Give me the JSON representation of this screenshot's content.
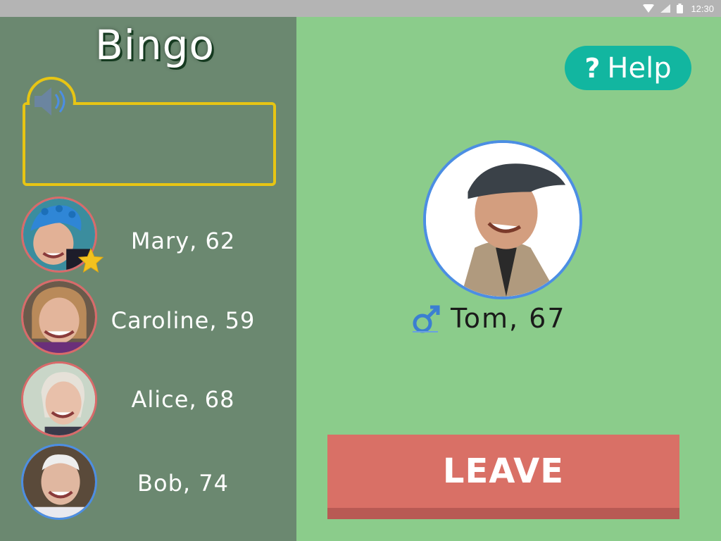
{
  "status_bar": {
    "time": "12:30",
    "icons": [
      "wifi-icon",
      "signal-icon",
      "battery-icon"
    ]
  },
  "app": {
    "title": "Bingo"
  },
  "call_box": {
    "icon": "speaker-icon",
    "text": ""
  },
  "players": [
    {
      "label": "Mary, 62",
      "avatar": "photo",
      "gender": "female",
      "starred": true
    },
    {
      "label": "Caroline, 59",
      "avatar": "photo",
      "gender": "female",
      "starred": false
    },
    {
      "label": "Alice, 68",
      "avatar": "photo",
      "gender": "female",
      "starred": false
    },
    {
      "label": "Bob, 74",
      "avatar": "photo",
      "gender": "male",
      "starred": false
    }
  ],
  "help": {
    "icon": "?",
    "label": "Help"
  },
  "current_user": {
    "label": "Tom, 67",
    "gender_icon": "male-symbol-icon"
  },
  "actions": {
    "leave_label": "LEAVE"
  },
  "colors": {
    "left_panel": "#6b8870",
    "right_panel": "#8bcc8b",
    "accent_yellow": "#e7c514",
    "help_teal": "#12b6a0",
    "leave_red": "#d97066",
    "female_border": "#d96a6a",
    "male_border": "#4c8ee3"
  }
}
